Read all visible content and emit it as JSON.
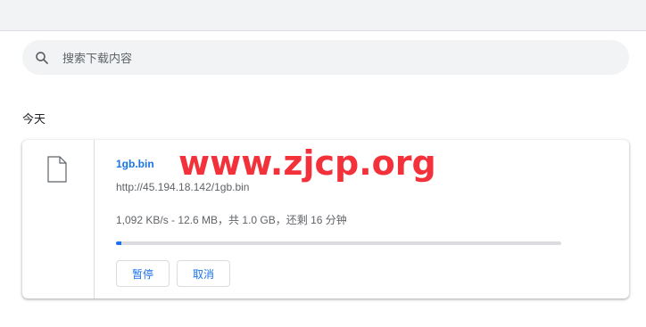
{
  "search": {
    "placeholder": "搜索下载内容",
    "icon": "search-icon"
  },
  "date_heading": "今天",
  "download": {
    "file_icon": "file-icon",
    "file_name": "1gb.bin",
    "url": "http://45.194.18.142/1gb.bin",
    "status": "1,092 KB/s - 12.6 MB，共 1.0 GB，还剩 16 分钟",
    "progress": 0.012,
    "buttons": {
      "pause": "暂停",
      "cancel": "取消"
    }
  },
  "watermark": "www.zjcp.org",
  "colors": {
    "accent": "#1a73e8",
    "watermark": "#f2313b"
  }
}
